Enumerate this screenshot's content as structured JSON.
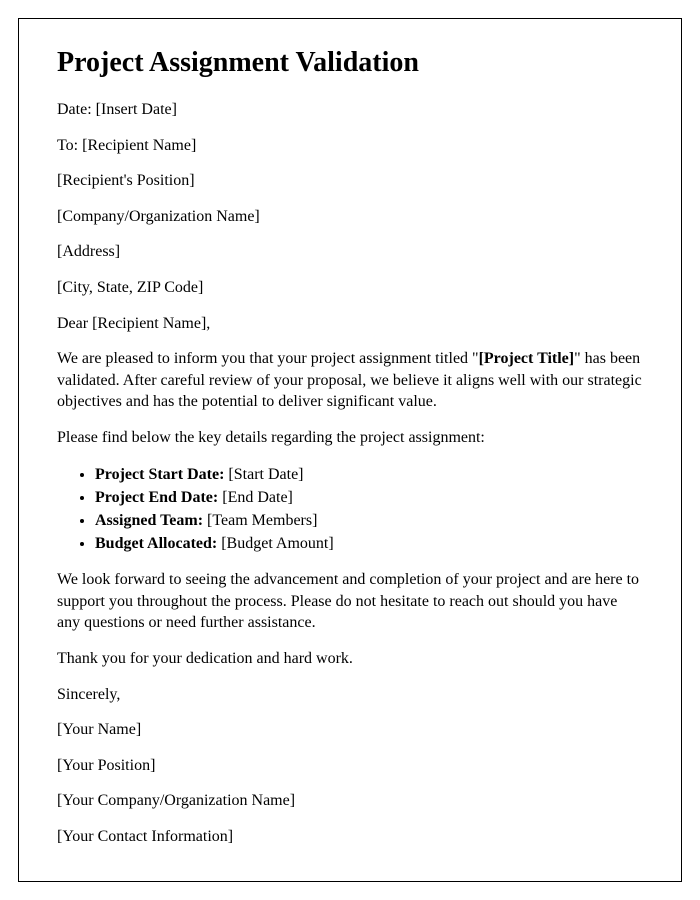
{
  "title": "Project Assignment Validation",
  "date_label": "Date: ",
  "date_value": "[Insert Date]",
  "to_label": "To: ",
  "to_value": "[Recipient Name]",
  "recipient_position": "[Recipient's Position]",
  "company_name": "[Company/Organization Name]",
  "address": "[Address]",
  "city_state_zip": "[City, State, ZIP Code]",
  "salutation_prefix": "Dear ",
  "salutation_name": "[Recipient Name]",
  "salutation_suffix": ",",
  "para1_a": "We are pleased to inform you that your project assignment titled \"",
  "para1_bold": "[Project Title]",
  "para1_b": "\" has been validated. After careful review of your proposal, we believe it aligns well with our strategic objectives and has the potential to deliver significant value.",
  "para2": "Please find below the key details regarding the project assignment:",
  "details": [
    {
      "label": "Project Start Date:",
      "value": " [Start Date]"
    },
    {
      "label": "Project End Date:",
      "value": " [End Date]"
    },
    {
      "label": "Assigned Team:",
      "value": " [Team Members]"
    },
    {
      "label": "Budget Allocated:",
      "value": " [Budget Amount]"
    }
  ],
  "para3": "We look forward to seeing the advancement and completion of your project and are here to support you throughout the process. Please do not hesitate to reach out should you have any questions or need further assistance.",
  "para4": "Thank you for your dedication and hard work.",
  "closing": "Sincerely,",
  "sender_name": "[Your Name]",
  "sender_position": "[Your Position]",
  "sender_company": "[Your Company/Organization Name]",
  "sender_contact": "[Your Contact Information]"
}
